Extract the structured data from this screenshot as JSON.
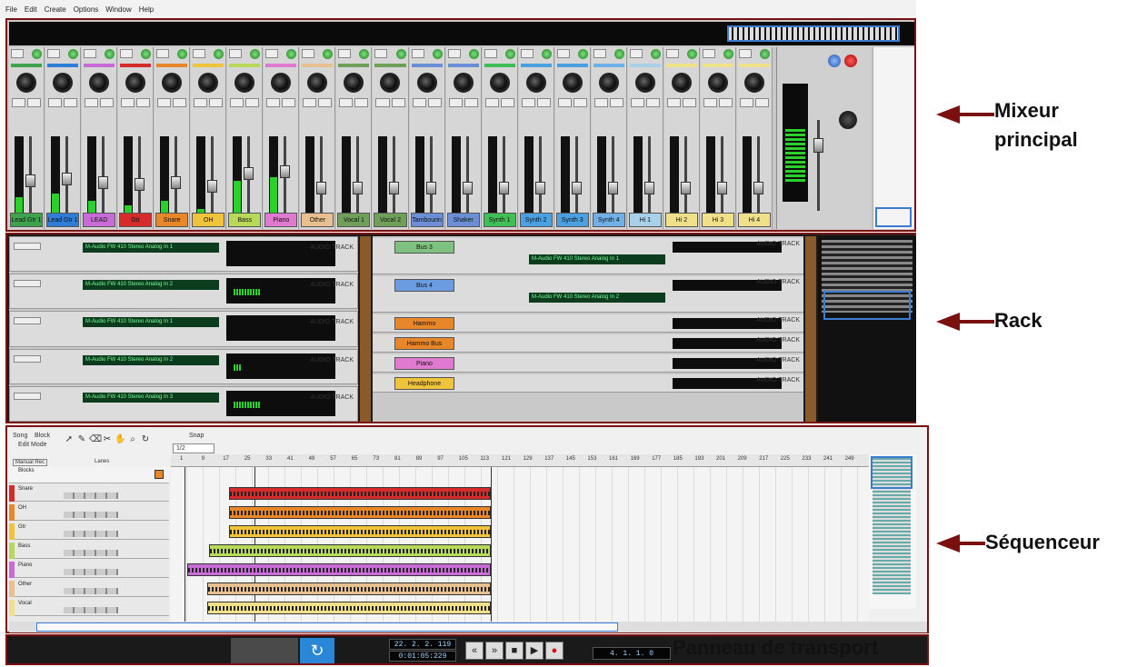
{
  "menu": [
    "File",
    "Edit",
    "Create",
    "Options",
    "Window",
    "Help"
  ],
  "annotations": {
    "mixer": "Mixeur principal",
    "rack": "Rack",
    "sequencer": "Séquenceur",
    "transport": "Panneau de transport"
  },
  "mixer": {
    "channels": [
      {
        "name": "Lead Gtr 1",
        "color": "#3fa34d",
        "level": 0.25
      },
      {
        "name": "Lead Gtr 1",
        "color": "#2f7dd6",
        "level": 0.3
      },
      {
        "name": "LEAD",
        "color": "#c86bd6",
        "level": 0.2
      },
      {
        "name": "Gtr",
        "color": "#d62b2b",
        "level": 0.15
      },
      {
        "name": "Snare",
        "color": "#e8862a",
        "level": 0.2
      },
      {
        "name": "OH",
        "color": "#f0c43a",
        "level": 0.1
      },
      {
        "name": "Bass",
        "color": "#b8d85a",
        "level": 0.45
      },
      {
        "name": "Piano",
        "color": "#e07ad0",
        "level": 0.5
      },
      {
        "name": "Other",
        "color": "#e8c090",
        "level": 0.05
      },
      {
        "name": "Vocal 1",
        "color": "#6fa05a",
        "level": 0.05
      },
      {
        "name": "Vocal 2",
        "color": "#6fa05a",
        "level": 0.05
      },
      {
        "name": "Tambourin",
        "color": "#6a8fd6",
        "level": 0.05
      },
      {
        "name": "Shaker",
        "color": "#6a8fd6",
        "level": 0.05
      },
      {
        "name": "Synth 1",
        "color": "#3fbf55",
        "level": 0.05
      },
      {
        "name": "Synth 2",
        "color": "#4aa0e0",
        "level": 0.05
      },
      {
        "name": "Synth 3",
        "color": "#4aa0e0",
        "level": 0.05
      },
      {
        "name": "Synth 4",
        "color": "#6fb0e8",
        "level": 0.05
      },
      {
        "name": "Hi 1",
        "color": "#a8d0e8",
        "level": 0.05
      },
      {
        "name": "Hi 2",
        "color": "#f0e08a",
        "level": 0.05
      },
      {
        "name": "Hi 3",
        "color": "#f0e08a",
        "level": 0.05
      },
      {
        "name": "Hi 4",
        "color": "#f0e08a",
        "level": 0.05
      }
    ]
  },
  "rack": {
    "left_devices": [
      {
        "display": "M-Audio FW 410 Stereo Analog In 1",
        "tag": "AUDIO TRACK",
        "level": 0.0
      },
      {
        "display": "M-Audio FW 410 Stereo Analog In 2",
        "tag": "AUDIO TRACK",
        "level": 0.3
      },
      {
        "display": "M-Audio FW 410 Stereo Analog In 1",
        "tag": "AUDIO TRACK",
        "level": 0.0
      },
      {
        "display": "M-Audio FW 410 Stereo Analog In 2",
        "tag": "AUDIO TRACK",
        "level": 0.08
      },
      {
        "display": "M-Audio FW 410 Stereo Analog In 3",
        "tag": "AUDIO TRACK",
        "level": 0.3
      }
    ],
    "mid_devices": [
      {
        "label": "Bus 3",
        "color": "#7fc27f",
        "display": "M-Audio FW 410 Stereo Analog In 1",
        "tag": "AUDIO TRACK"
      },
      {
        "label": "Bus 4",
        "color": "#6b9be0",
        "display": "M-Audio FW 410 Stereo Analog In 2",
        "tag": "AUDIO TRACK"
      },
      {
        "label": "Hammo",
        "color": "#e8862a",
        "display": "",
        "tag": "AUDIO TRACK"
      },
      {
        "label": "Hammo Bus",
        "color": "#e8862a",
        "display": "",
        "tag": "AUDIO TRACK"
      },
      {
        "label": "Piano",
        "color": "#e07ad0",
        "display": "",
        "tag": "AUDIO TRACK"
      },
      {
        "label": "Headphone",
        "color": "#f0c43a",
        "display": "",
        "tag": "AUDIO TRACK"
      }
    ]
  },
  "sequencer": {
    "tabs": [
      "Song",
      "Block"
    ],
    "edit_mode": "Edit Mode",
    "snap_label": "Snap",
    "snap_value": "1/2",
    "lanes_label": "Lanes",
    "manual_rec": "Manual Rec",
    "blocks_label": "Blocks",
    "ruler": [
      "1",
      "9",
      "17",
      "25",
      "33",
      "41",
      "49",
      "57",
      "65",
      "73",
      "81",
      "89",
      "97",
      "105",
      "113",
      "121",
      "129",
      "137",
      "145",
      "153",
      "161",
      "169",
      "177",
      "185",
      "193",
      "201",
      "209",
      "217",
      "225",
      "233",
      "241",
      "249"
    ],
    "tracks": [
      {
        "name": "Snare",
        "color": "#d62b2b"
      },
      {
        "name": "OH",
        "color": "#e8862a"
      },
      {
        "name": "Gtr",
        "color": "#f0c43a"
      },
      {
        "name": "Bass",
        "color": "#b8d85a"
      },
      {
        "name": "Piano",
        "color": "#c86bd6"
      },
      {
        "name": "Other",
        "color": "#e8c090"
      },
      {
        "name": "Vocal",
        "color": "#f0e08a"
      }
    ]
  },
  "transport": {
    "position": "22. 2. 2. 119",
    "time": "0:01:05:229",
    "loop": "4. 1. 1. 0",
    "buttons": [
      "«",
      "»",
      "■",
      "▶",
      "●"
    ]
  }
}
